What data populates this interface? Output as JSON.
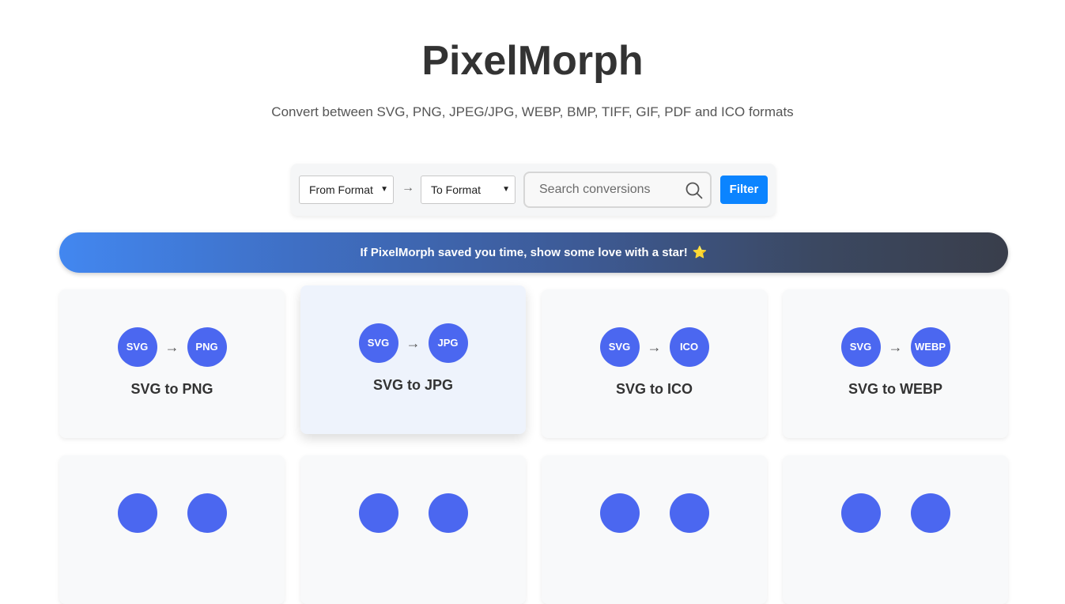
{
  "header": {
    "title": "PixelMorph",
    "subtitle": "Convert between SVG, PNG, JPEG/JPG, WEBP, BMP, TIFF, GIF, PDF and ICO formats"
  },
  "filter": {
    "from_label": "From Format",
    "to_label": "To Format",
    "arrow": "→",
    "search_placeholder": "Search conversions",
    "button_label": "Filter"
  },
  "banner": {
    "text": "If PixelMorph saved you time, show some love with a star!",
    "emoji": "⭐"
  },
  "cards": [
    {
      "from": "SVG",
      "to": "PNG",
      "label": "SVG to PNG"
    },
    {
      "from": "SVG",
      "to": "JPG",
      "label": "SVG to JPG"
    },
    {
      "from": "SVG",
      "to": "ICO",
      "label": "SVG to ICO"
    },
    {
      "from": "SVG",
      "to": "WEBP",
      "label": "SVG to WEBP"
    }
  ],
  "card_arrow": "→",
  "colors": {
    "accent": "#0b84ff",
    "badge": "#4b67f0",
    "banner_start": "#4287f0",
    "banner_end": "#393e4b"
  }
}
